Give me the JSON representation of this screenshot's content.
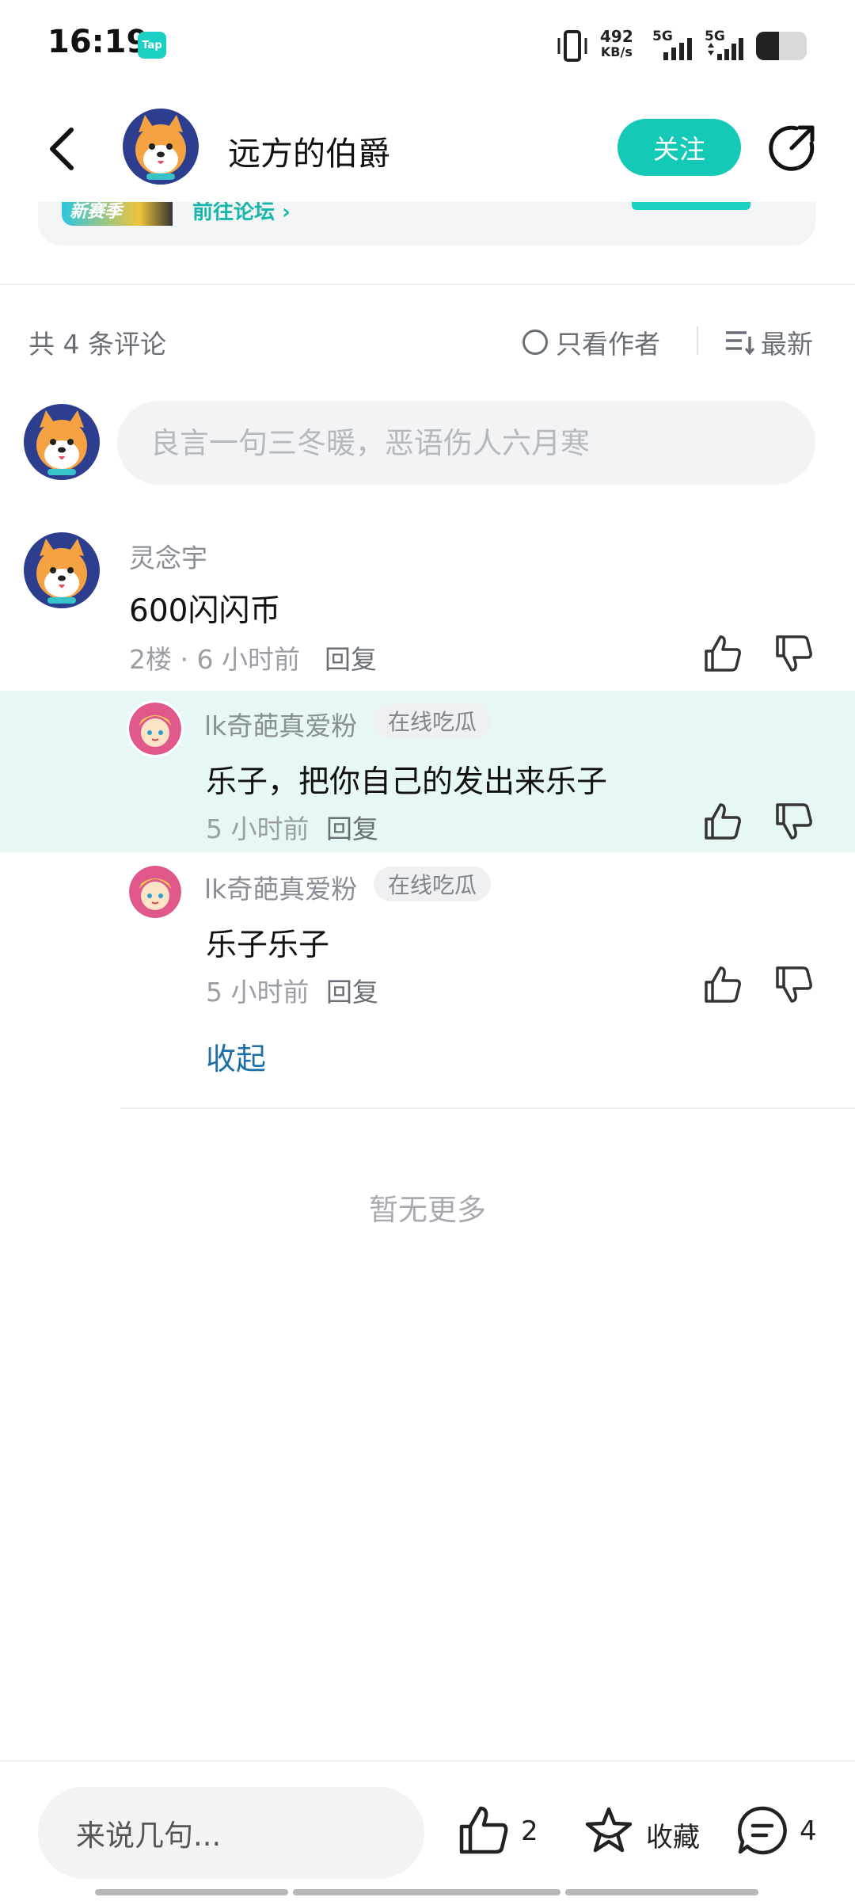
{
  "status_bar": {
    "time": "16:19",
    "tap_badge": "Tap",
    "net_speed_value": "492",
    "net_speed_unit": "KB/s",
    "sim1_label": "5G",
    "sim2_label": "5G",
    "battery_level": 0.45
  },
  "header": {
    "title": "远方的伯爵",
    "follow_label": "关注",
    "back_icon": "chevron-left-icon",
    "share_icon": "share-arrow-icon"
  },
  "banner": {
    "image_text": "新赛季",
    "link_label": "前往论坛"
  },
  "comments_header": {
    "count_text": "共 4 条评论",
    "only_author_label": "只看作者",
    "sort_label": "最新"
  },
  "comment_input": {
    "placeholder": "良言一句三冬暖，恶语伤人六月寒"
  },
  "comment": {
    "author": "灵念宇",
    "text": "600闪闪币",
    "meta": "2楼 · 6 小时前",
    "reply_label": "回复"
  },
  "replies": [
    {
      "author": "lk奇葩真爱粉",
      "badge": "在线吃瓜",
      "text": "乐子，把你自己的发出来乐子",
      "time": "5 小时前",
      "reply_label": "回复"
    },
    {
      "author": "lk奇葩真爱粉",
      "badge": "在线吃瓜",
      "text": "乐子乐子",
      "time": "5 小时前",
      "reply_label": "回复"
    }
  ],
  "collapse_label": "收起",
  "no_more_label": "暂无更多",
  "bottom_bar": {
    "input_label": "来说几句...",
    "like_count": "2",
    "favorite_label": "收藏",
    "comment_count": "4"
  }
}
